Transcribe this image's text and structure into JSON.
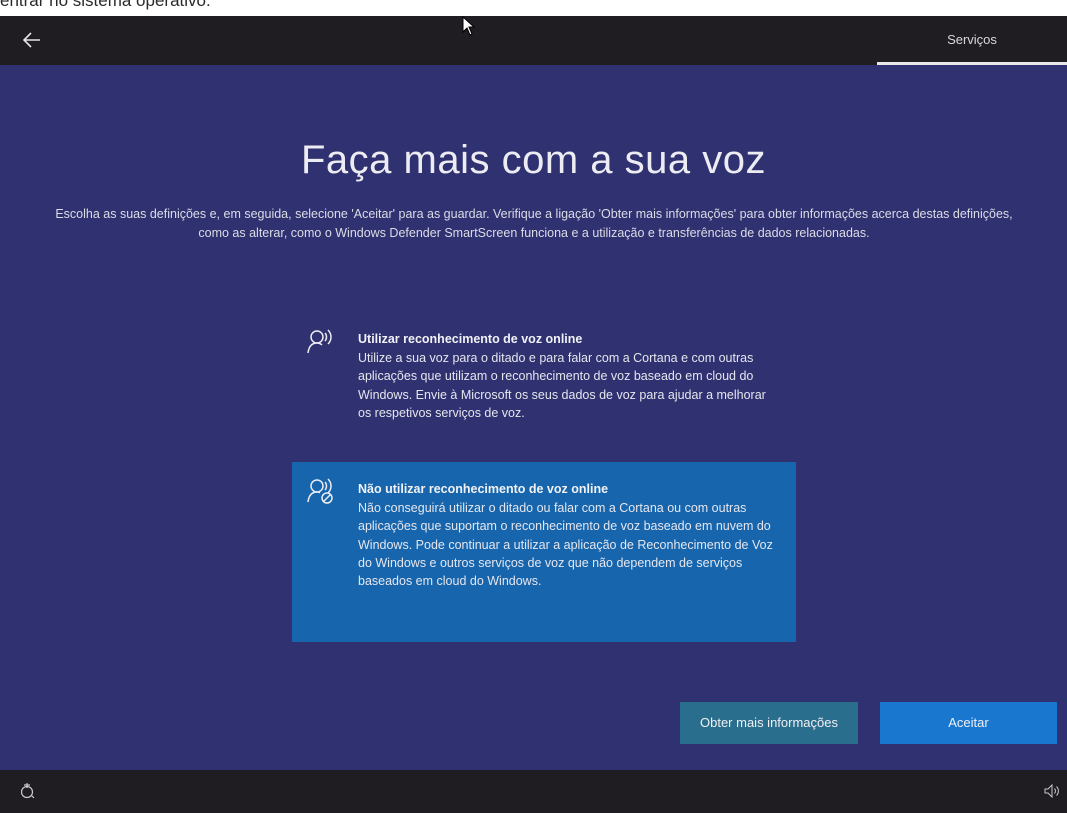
{
  "caption": "entrar no sistema operativo.",
  "header": {
    "back_icon": "back-arrow-icon",
    "tab_label": "Serviços"
  },
  "main": {
    "title": "Faça mais com a sua voz",
    "subtitle": "Escolha as suas definições e, em seguida, selecione 'Aceitar' para as guardar. Verifique a ligação 'Obter mais informações' para obter informações acerca destas definições, como as alterar, como o Windows Defender SmartScreen funciona e a utilização e transferências de dados relacionadas."
  },
  "options": [
    {
      "icon": "speech-recognition-icon",
      "title": "Utilizar reconhecimento de voz online",
      "description": "Utilize a sua voz para o ditado e para falar com a Cortana e com outras aplicações que utilizam o reconhecimento de voz baseado em cloud do Windows. Envie à Microsoft os seus dados de voz para ajudar a melhorar os respetivos serviços de voz.",
      "selected": false
    },
    {
      "icon": "speech-recognition-off-icon",
      "title": "Não utilizar reconhecimento de voz online",
      "description": "Não conseguirá utilizar o ditado ou falar com a Cortana ou com outras aplicações que suportam o reconhecimento de voz baseado em nuvem do Windows. Pode continuar a utilizar a aplicação de Reconhecimento de Voz do Windows e outros serviços de voz que não dependem de serviços baseados em cloud do Windows.",
      "selected": true
    }
  ],
  "buttons": {
    "more_info": "Obter mais informações",
    "accept": "Aceitar"
  },
  "footer": {
    "accessibility_icon": "accessibility-icon",
    "volume_icon": "volume-icon"
  },
  "colors": {
    "background": "#2f3170",
    "selected_option": "#1665ad",
    "accept_button": "#1977d0",
    "more_info_button": "#2a6e8e"
  }
}
